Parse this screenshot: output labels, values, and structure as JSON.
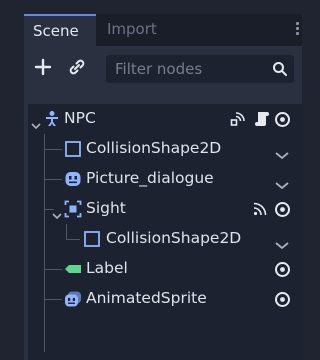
{
  "tabs": [
    {
      "label": "Scene",
      "active": true
    },
    {
      "label": "Import",
      "active": false
    }
  ],
  "toolbar": {
    "add_icon": "plus-icon",
    "link_icon": "link-icon",
    "filter_placeholder": "Filter nodes",
    "filter_value": "",
    "search_icon": "search-icon"
  },
  "tree": [
    {
      "label": "NPC",
      "icon": "kinematic-body-icon",
      "expanded": true,
      "status": [
        "signals-icon",
        "script-icon",
        "visibility-icon"
      ]
    },
    {
      "label": "CollisionShape2D",
      "icon": "collision-shape-icon",
      "status": [
        "chevron-down-icon"
      ]
    },
    {
      "label": "Picture_dialogue",
      "icon": "sprite-icon",
      "status": [
        "chevron-down-icon"
      ]
    },
    {
      "label": "Sight",
      "icon": "area2d-icon",
      "expanded": true,
      "status": [
        "signals-icon",
        "visibility-icon"
      ]
    },
    {
      "label": "CollisionShape2D",
      "icon": "collision-shape-icon",
      "status": [
        "chevron-down-icon"
      ]
    },
    {
      "label": "Label",
      "icon": "label-icon",
      "status": [
        "visibility-icon"
      ]
    },
    {
      "label": "AnimatedSprite",
      "icon": "animated-sprite-icon",
      "status": [
        "visibility-icon"
      ]
    }
  ],
  "colors": {
    "panel": "#2a3040",
    "tree_bg": "#1d2230",
    "accent_blue": "#5f8be8",
    "node_blue": "#8fb4ff",
    "label_green": "#5fd68c"
  }
}
